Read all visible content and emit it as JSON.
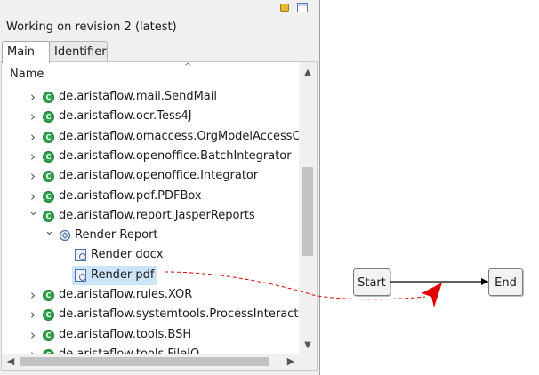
{
  "panel": {
    "revision_text": "Working on revision 2 (latest)",
    "toolbar_icons": [
      "pin-icon",
      "table-icon"
    ],
    "tabs": [
      {
        "label": "Main",
        "active": true
      },
      {
        "label": "Identifier",
        "active": false
      }
    ],
    "tree": {
      "column_header": "Name",
      "rows": [
        {
          "label": "de.aristaflow.mail.SendMail",
          "icon": "package-icon",
          "expanded": false,
          "level": 0
        },
        {
          "label": "de.aristaflow.ocr.Tess4J",
          "icon": "package-icon",
          "expanded": false,
          "level": 0
        },
        {
          "label": "de.aristaflow.omaccess.OrgModelAccessCo",
          "icon": "package-icon",
          "expanded": false,
          "level": 0
        },
        {
          "label": "de.aristaflow.openoffice.BatchIntegrator",
          "icon": "package-icon",
          "expanded": false,
          "level": 0
        },
        {
          "label": "de.aristaflow.openoffice.Integrator",
          "icon": "package-icon",
          "expanded": false,
          "level": 0
        },
        {
          "label": "de.aristaflow.pdf.PDFBox",
          "icon": "package-icon",
          "expanded": false,
          "level": 0
        },
        {
          "label": "de.aristaflow.report.JasperReports",
          "icon": "package-icon",
          "expanded": true,
          "level": 0
        },
        {
          "label": "Render Report",
          "icon": "runtime-component-icon",
          "expanded": true,
          "level": 1
        },
        {
          "label": "Render docx",
          "icon": "operation-icon",
          "expanded": null,
          "level": 2
        },
        {
          "label": "Render pdf",
          "icon": "operation-icon",
          "expanded": null,
          "level": 2,
          "selected": true
        },
        {
          "label": "de.aristaflow.rules.XOR",
          "icon": "package-icon",
          "expanded": false,
          "level": 0
        },
        {
          "label": "de.aristaflow.systemtools.ProcessInteractio",
          "icon": "package-icon",
          "expanded": false,
          "level": 0
        },
        {
          "label": "de.aristaflow.tools.BSH",
          "icon": "package-icon",
          "expanded": false,
          "level": 0
        },
        {
          "label": "de.aristaflow.tools.FileIO",
          "icon": "package-icon",
          "expanded": false,
          "level": 0
        }
      ]
    }
  },
  "process": {
    "nodes": [
      {
        "id": "start",
        "label": "Start"
      },
      {
        "id": "end",
        "label": "End"
      }
    ],
    "drag_arrow_color": "#e00000"
  }
}
